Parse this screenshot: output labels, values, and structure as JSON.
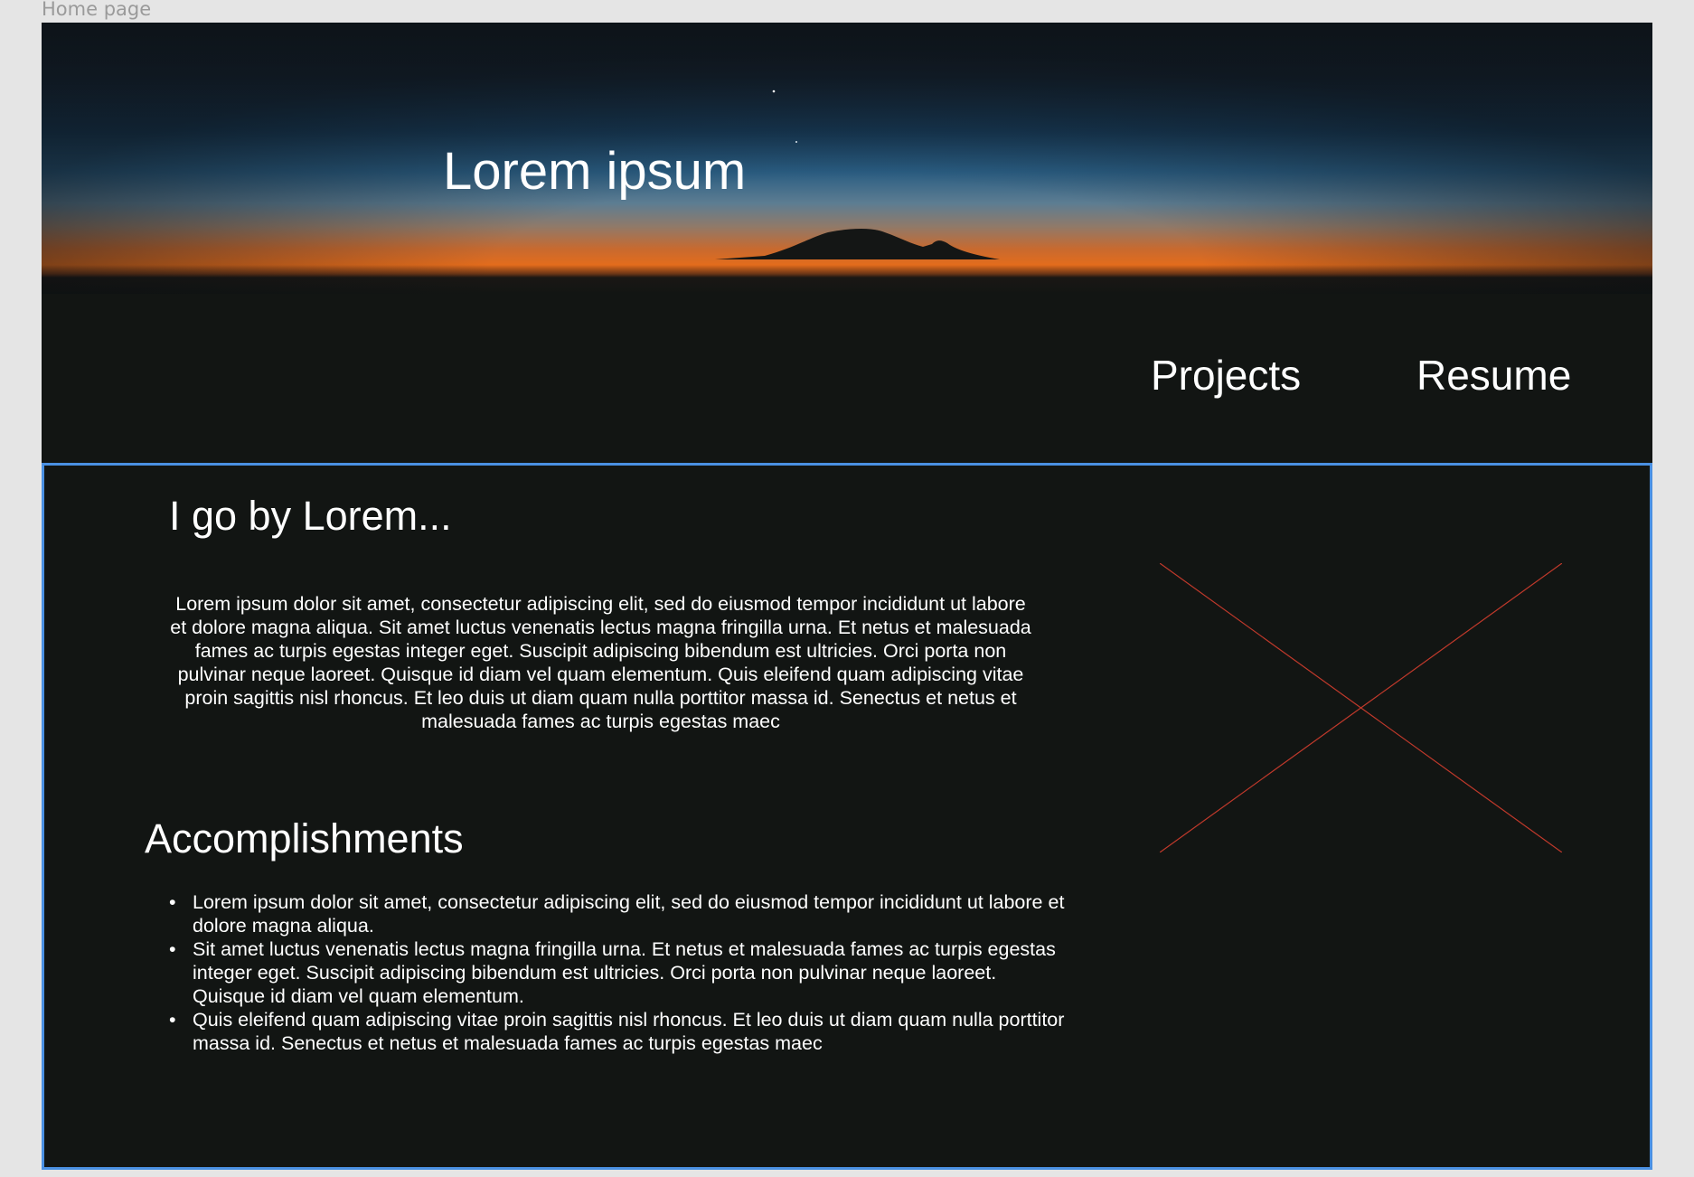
{
  "frame": {
    "label": "Home page"
  },
  "hero": {
    "title": "Lorem ipsum",
    "nav": {
      "projects": "Projects",
      "resume": "Resume"
    }
  },
  "about": {
    "heading": "I go by Lorem...",
    "body": "Lorem ipsum dolor sit amet, consectetur adipiscing elit, sed do eiusmod tempor incididunt ut labore et dolore magna aliqua. Sit amet luctus venenatis lectus magna fringilla urna. Et netus et malesuada fames ac turpis egestas integer eget. Suscipit adipiscing bibendum est ultricies. Orci porta non pulvinar neque laoreet. Quisque id diam vel quam elementum. Quis eleifend quam adipiscing vitae proin sagittis nisl rhoncus. Et leo duis ut diam quam nulla porttitor massa id. Senectus et netus et malesuada fames ac turpis egestas maec"
  },
  "accomplishments": {
    "heading": "Accomplishments",
    "items": [
      "Lorem ipsum dolor sit amet, consectetur adipiscing elit, sed do eiusmod tempor incididunt ut labore et dolore magna aliqua.",
      "Sit amet luctus venenatis lectus magna fringilla urna. Et netus et malesuada fames ac turpis egestas integer eget. Suscipit adipiscing bibendum est ultricies. Orci porta non pulvinar neque laoreet. Quisque id diam vel quam elementum.",
      "Quis eleifend quam adipiscing vitae proin sagittis nisl rhoncus. Et leo duis ut diam quam nulla porttitor massa id. Senectus et netus et malesuada fames ac turpis egestas maec"
    ],
    "bullet": "•"
  },
  "colors": {
    "page_background": "#e5e5e5",
    "frame_background": "#121513",
    "selection_border": "#4a90e2",
    "placeholder_stroke": "#c0392b",
    "text": "#ffffff"
  }
}
